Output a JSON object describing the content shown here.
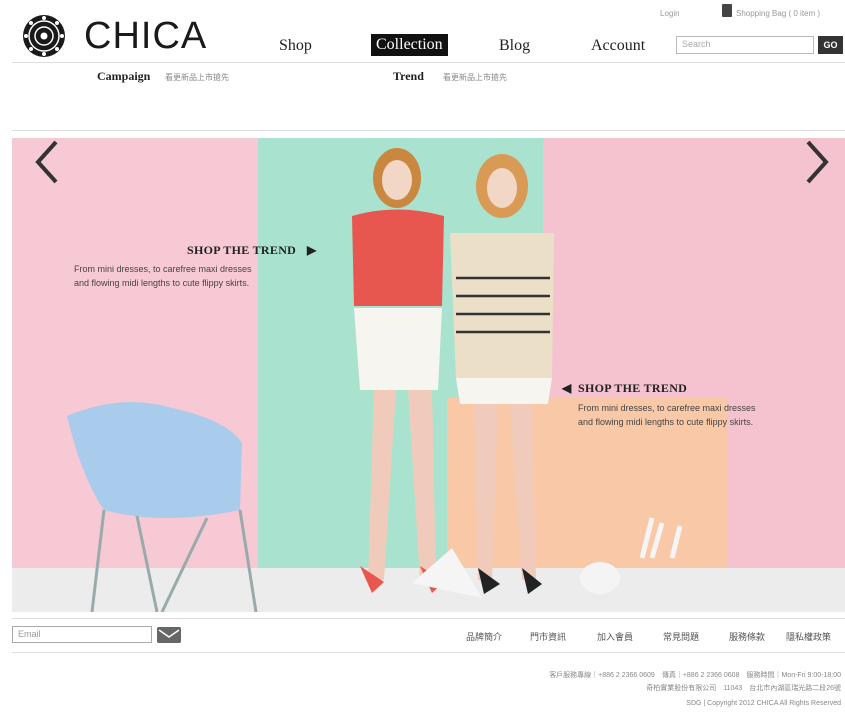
{
  "header": {
    "brand": "CHICA",
    "nav": [
      "Shop",
      "Collection",
      "Blog",
      "Account"
    ],
    "active_nav": "Collection",
    "login": "Login",
    "bag": "Shopping Bag ( 0 item )",
    "search_placeholder": "Search",
    "search_button": "GO"
  },
  "subnav": {
    "campaign": "Campaign",
    "campaign_note": "看更新品上市搶先",
    "trend": "Trend",
    "trend_note": "看更新品上市搶先"
  },
  "hero": {
    "promo_left": {
      "title": "SHOP THE TREND",
      "line1": "From mini dresses, to carefree maxi dresses",
      "line2": "and flowing midi lengths to cute flippy skirts."
    },
    "promo_right": {
      "title": "SHOP THE TREND",
      "line1": "From mini dresses, to carefree maxi dresses",
      "line2": "and flowing midi lengths to cute flippy skirts."
    },
    "colors": {
      "pink": "#f6c9d4",
      "mint": "#a9e3cf",
      "peach": "#f9c8a7",
      "chair": "#a9cbec"
    },
    "prev_icon": "chevron-left-icon",
    "next_icon": "chevron-right-icon"
  },
  "footer": {
    "email_placeholder": "Email",
    "links": [
      "品牌簡介",
      "門市資訊",
      "加入會員",
      "常見問題",
      "服務條款",
      "隱私權政策"
    ],
    "info_line1": "客戶服務專線｜+886 2 2366 0609　傳真｜+886 2 2366 0608　服務時間｜Mon-Fri 9:00-18:00",
    "info_line2": "奇柏實業股份有限公司　11043　台北市內湖區瑞光路二段26號",
    "copyright": "SDG | Copyright 2012 CHICA All Rights Reserved"
  }
}
